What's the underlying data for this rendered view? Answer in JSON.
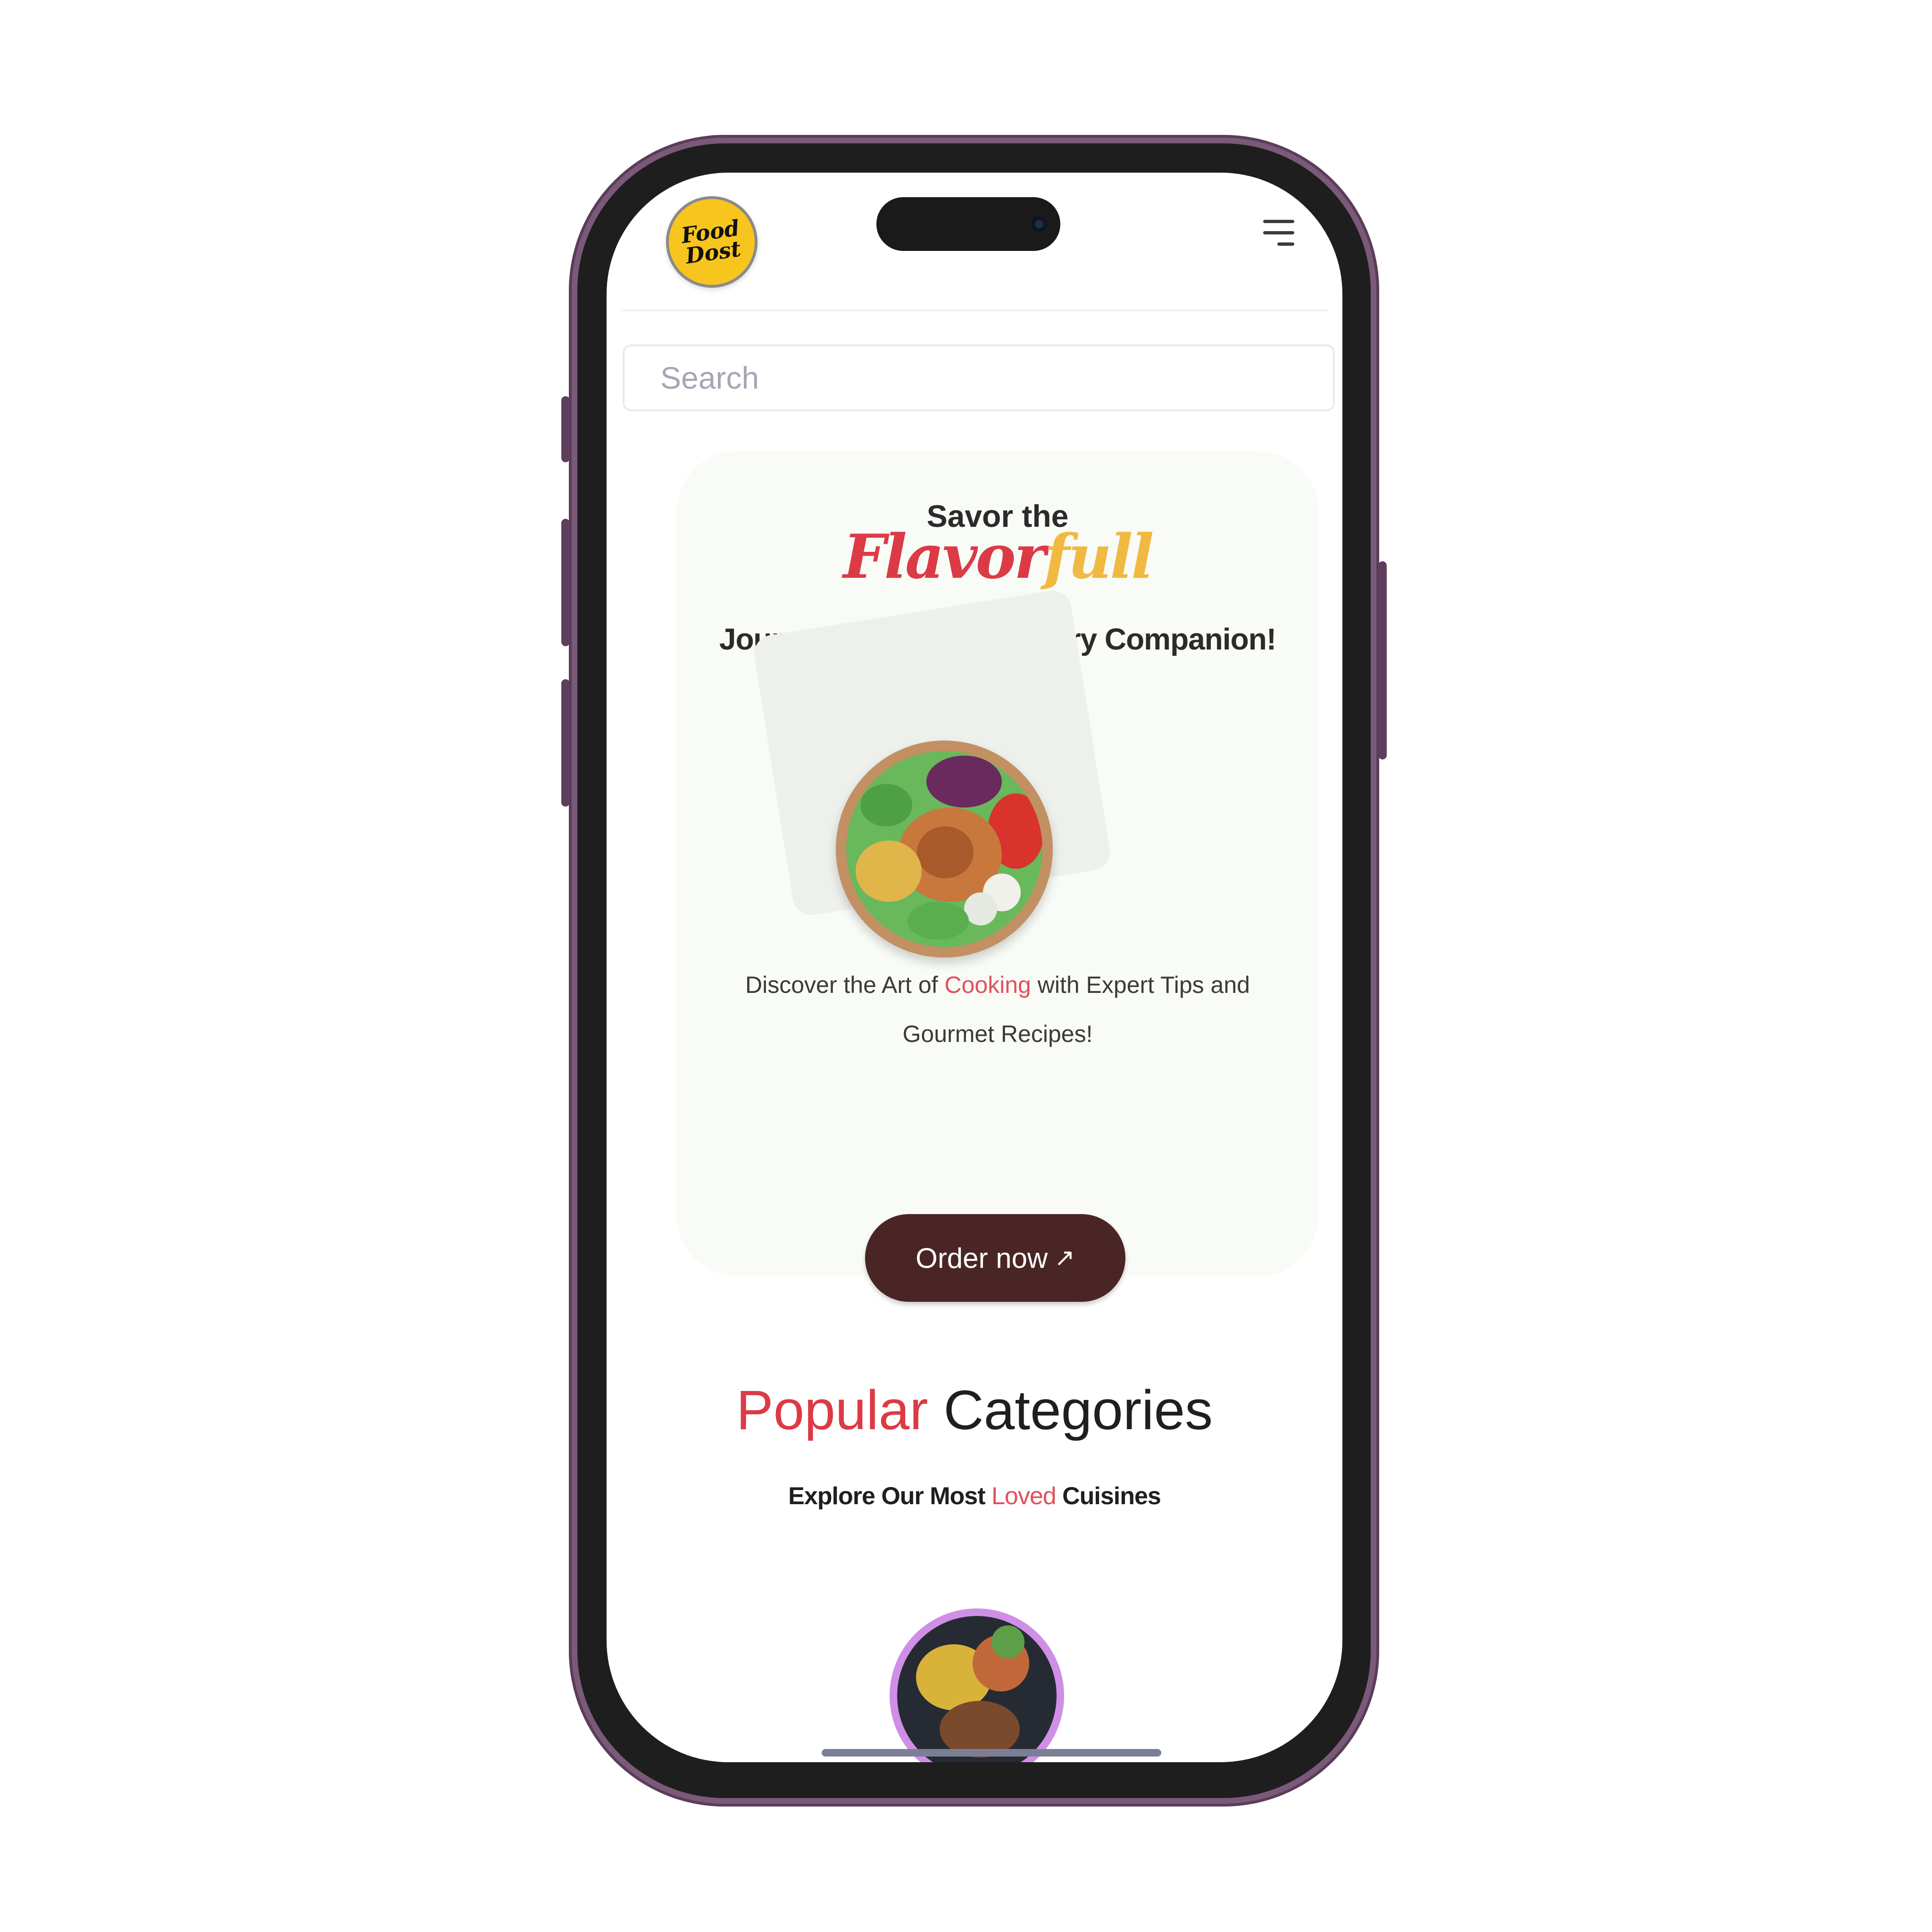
{
  "header": {
    "logo_line1": "Food",
    "logo_line2": "Dost"
  },
  "search": {
    "placeholder": "Search"
  },
  "hero": {
    "line1": "Savor the",
    "flavor_part1": "Flavor",
    "flavor_part2": "full",
    "line3": "Journey with Your Culinary Companion!",
    "desc_before": "Discover the Art of ",
    "desc_accent": "Cooking",
    "desc_after": " with Expert Tips and Gourmet Recipes!",
    "order_button": "Order now",
    "order_arrow": "↗"
  },
  "categories": {
    "title_accent": "Popular",
    "title_rest": " Categories",
    "sub_before": "Explore Our Most ",
    "sub_accent": "Loved",
    "sub_after": " Cuisines"
  },
  "colors": {
    "accent_red": "#dc3a45",
    "accent_yellow": "#f0b941",
    "button_bg": "#4a2525",
    "hero_bg": "#f8fbf6",
    "phone_frame": "#7a5a78"
  },
  "icons": {
    "menu": "hamburger-menu-icon",
    "order_arrow": "arrow-up-right-icon"
  }
}
